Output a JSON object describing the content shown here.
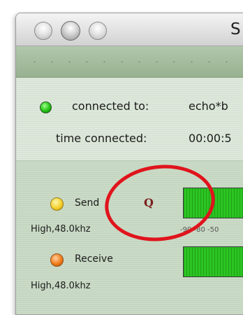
{
  "window": {
    "title": "S"
  },
  "connection": {
    "connected_label": "connected to:",
    "connected_value": "echo*b",
    "time_label": "time connected:",
    "time_value": "00:00:5",
    "status_color": "#22c212"
  },
  "send": {
    "label": "Send",
    "quality": "High,48.0khz",
    "led_color": "#f3d22c"
  },
  "receive": {
    "label": "Receive",
    "quality": "High,48.0khz",
    "led_color": "#f07c18"
  },
  "meter": {
    "scale": "-90 -80 -50"
  },
  "annotation": {
    "letter": "Q",
    "circle_color": "#e0141c"
  }
}
